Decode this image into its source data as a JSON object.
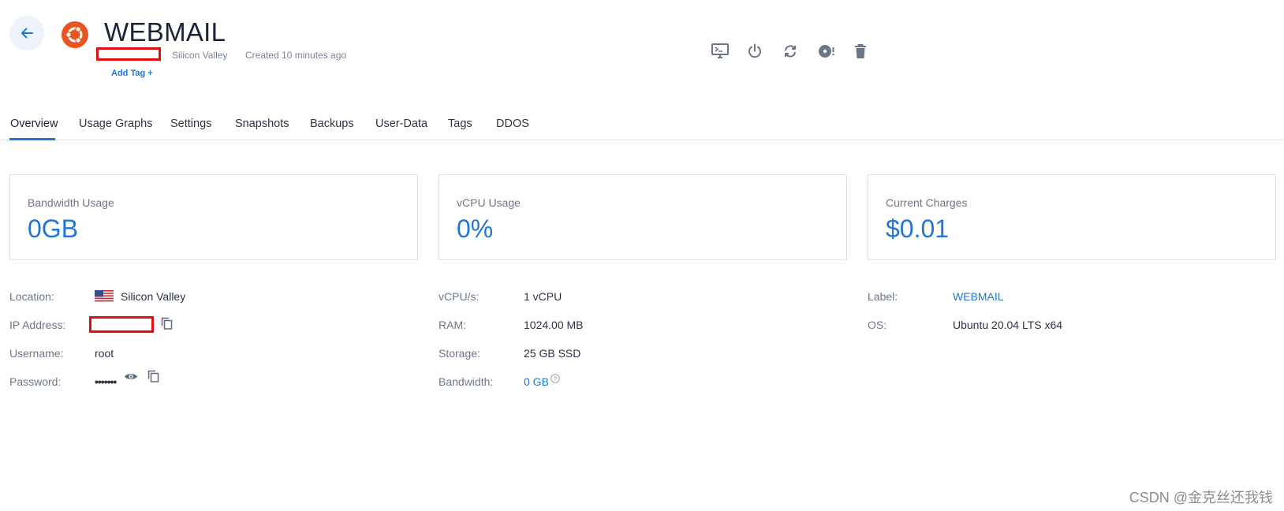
{
  "header": {
    "title": "WEBMAIL",
    "location": "Silicon Valley",
    "created": "Created 10 minutes ago",
    "add_tag": "Add Tag +"
  },
  "actions": [
    "view-console",
    "server-stop",
    "server-restart",
    "server-reinstall",
    "server-destroy"
  ],
  "tabs": [
    {
      "label": "Overview",
      "active": true
    },
    {
      "label": "Usage Graphs"
    },
    {
      "label": "Settings"
    },
    {
      "label": "Snapshots"
    },
    {
      "label": "Backups"
    },
    {
      "label": "User-Data"
    },
    {
      "label": "Tags"
    },
    {
      "label": "DDOS"
    }
  ],
  "cards": [
    {
      "label": "Bandwidth Usage",
      "value": "0GB"
    },
    {
      "label": "vCPU Usage",
      "value": "0%"
    },
    {
      "label": "Current Charges",
      "value": "$0.01"
    }
  ],
  "info_left": {
    "location_label": "Location:",
    "location_value": "Silicon Valley",
    "ip_label": "IP Address:",
    "username_label": "Username:",
    "username_value": "root",
    "password_label": "Password:",
    "password_value": "•••••••"
  },
  "info_mid": {
    "vcpu_label": "vCPU/s:",
    "vcpu_value": "1 vCPU",
    "ram_label": "RAM:",
    "ram_value": "1024.00 MB",
    "storage_label": "Storage:",
    "storage_value": "25 GB SSD",
    "bandwidth_label": "Bandwidth:",
    "bandwidth_value": "0 GB"
  },
  "info_right": {
    "label_label": "Label:",
    "label_value": "WEBMAIL",
    "os_label": "OS:",
    "os_value": "Ubuntu 20.04 LTS x64"
  },
  "watermark": "CSDN @金克丝还我钱",
  "colors": {
    "accent": "#1f76d6",
    "ubuntu": "#e95420",
    "redaction": "#e01010"
  }
}
